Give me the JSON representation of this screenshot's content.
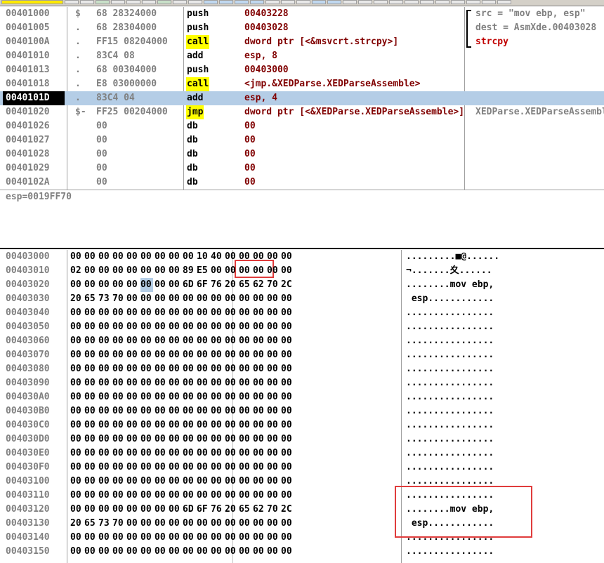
{
  "disasm": {
    "rows": [
      {
        "addr": "00401000",
        "mark": "$",
        "hex": "68 28324000",
        "mn": "push",
        "op": "00403228",
        "cm": "src = \"mov ebp, esp\""
      },
      {
        "addr": "00401005",
        "mark": ".",
        "hex": "68 28304000",
        "mn": "push",
        "op": "00403028",
        "cm": "dest = AsmXde.00403028"
      },
      {
        "addr": "0040100A",
        "mark": ".",
        "hex": "FF15 08204000",
        "mn": "call",
        "op": "dword ptr [<&msvcrt.strcpy>]",
        "cm": "strcpy"
      },
      {
        "addr": "00401010",
        "mark": ".",
        "hex": "83C4 08",
        "mn": "add",
        "op": "esp, 8",
        "cm": ""
      },
      {
        "addr": "00401013",
        "mark": ".",
        "hex": "68 00304000",
        "mn": "push",
        "op": "00403000",
        "cm": ""
      },
      {
        "addr": "00401018",
        "mark": ".",
        "hex": "E8 03000000",
        "mn": "call",
        "op": "<jmp.&XEDParse.XEDParseAssemble>",
        "cm": ""
      },
      {
        "addr": "0040101D",
        "mark": ".",
        "hex": "83C4 04",
        "mn": "add",
        "op": "esp, 4",
        "cm": ""
      },
      {
        "addr": "00401020",
        "mark": "$-",
        "hex": "FF25 00204000",
        "mn": "jmp",
        "op": "dword ptr [<&XEDParse.XEDParseAssemble>]",
        "cm": "XEDParse.XEDParseAssemble"
      },
      {
        "addr": "00401026",
        "mark": "",
        "hex": "00",
        "mn": "db",
        "op": "00",
        "cm": ""
      },
      {
        "addr": "00401027",
        "mark": "",
        "hex": "00",
        "mn": "db",
        "op": "00",
        "cm": ""
      },
      {
        "addr": "00401028",
        "mark": "",
        "hex": "00",
        "mn": "db",
        "op": "00",
        "cm": ""
      },
      {
        "addr": "00401029",
        "mark": "",
        "hex": "00",
        "mn": "db",
        "op": "00",
        "cm": ""
      },
      {
        "addr": "0040102A",
        "mark": "",
        "hex": "00",
        "mn": "db",
        "op": "00",
        "cm": ""
      }
    ]
  },
  "info": {
    "text": "esp=0019FF70"
  },
  "dump": {
    "rows": [
      {
        "addr": "00403000",
        "bytes": [
          "00",
          "00",
          "00",
          "00",
          "00",
          "00",
          "00",
          "00",
          "00",
          "10",
          "40",
          "00",
          "00",
          "00",
          "00",
          "00"
        ],
        "ascii": ".........■@......"
      },
      {
        "addr": "00403010",
        "bytes": [
          "02",
          "00",
          "00",
          "00",
          "00",
          "00",
          "00",
          "00",
          "89",
          "E5",
          "00",
          "00",
          "00",
          "00",
          "00",
          "00"
        ],
        "ascii": "¬.......夊......"
      },
      {
        "addr": "00403020",
        "bytes": [
          "00",
          "00",
          "00",
          "00",
          "00",
          "00",
          "00",
          "00",
          "6D",
          "6F",
          "76",
          "20",
          "65",
          "62",
          "70",
          "2C"
        ],
        "ascii": "........mov ebp,"
      },
      {
        "addr": "00403030",
        "bytes": [
          "20",
          "65",
          "73",
          "70",
          "00",
          "00",
          "00",
          "00",
          "00",
          "00",
          "00",
          "00",
          "00",
          "00",
          "00",
          "00"
        ],
        "ascii": " esp............"
      },
      {
        "addr": "00403040",
        "bytes": [
          "00",
          "00",
          "00",
          "00",
          "00",
          "00",
          "00",
          "00",
          "00",
          "00",
          "00",
          "00",
          "00",
          "00",
          "00",
          "00"
        ],
        "ascii": "................"
      },
      {
        "addr": "00403050",
        "bytes": [
          "00",
          "00",
          "00",
          "00",
          "00",
          "00",
          "00",
          "00",
          "00",
          "00",
          "00",
          "00",
          "00",
          "00",
          "00",
          "00"
        ],
        "ascii": "................"
      },
      {
        "addr": "00403060",
        "bytes": [
          "00",
          "00",
          "00",
          "00",
          "00",
          "00",
          "00",
          "00",
          "00",
          "00",
          "00",
          "00",
          "00",
          "00",
          "00",
          "00"
        ],
        "ascii": "................"
      },
      {
        "addr": "00403070",
        "bytes": [
          "00",
          "00",
          "00",
          "00",
          "00",
          "00",
          "00",
          "00",
          "00",
          "00",
          "00",
          "00",
          "00",
          "00",
          "00",
          "00"
        ],
        "ascii": "................"
      },
      {
        "addr": "00403080",
        "bytes": [
          "00",
          "00",
          "00",
          "00",
          "00",
          "00",
          "00",
          "00",
          "00",
          "00",
          "00",
          "00",
          "00",
          "00",
          "00",
          "00"
        ],
        "ascii": "................"
      },
      {
        "addr": "00403090",
        "bytes": [
          "00",
          "00",
          "00",
          "00",
          "00",
          "00",
          "00",
          "00",
          "00",
          "00",
          "00",
          "00",
          "00",
          "00",
          "00",
          "00"
        ],
        "ascii": "................"
      },
      {
        "addr": "004030A0",
        "bytes": [
          "00",
          "00",
          "00",
          "00",
          "00",
          "00",
          "00",
          "00",
          "00",
          "00",
          "00",
          "00",
          "00",
          "00",
          "00",
          "00"
        ],
        "ascii": "................"
      },
      {
        "addr": "004030B0",
        "bytes": [
          "00",
          "00",
          "00",
          "00",
          "00",
          "00",
          "00",
          "00",
          "00",
          "00",
          "00",
          "00",
          "00",
          "00",
          "00",
          "00"
        ],
        "ascii": "................"
      },
      {
        "addr": "004030C0",
        "bytes": [
          "00",
          "00",
          "00",
          "00",
          "00",
          "00",
          "00",
          "00",
          "00",
          "00",
          "00",
          "00",
          "00",
          "00",
          "00",
          "00"
        ],
        "ascii": "................"
      },
      {
        "addr": "004030D0",
        "bytes": [
          "00",
          "00",
          "00",
          "00",
          "00",
          "00",
          "00",
          "00",
          "00",
          "00",
          "00",
          "00",
          "00",
          "00",
          "00",
          "00"
        ],
        "ascii": "................"
      },
      {
        "addr": "004030E0",
        "bytes": [
          "00",
          "00",
          "00",
          "00",
          "00",
          "00",
          "00",
          "00",
          "00",
          "00",
          "00",
          "00",
          "00",
          "00",
          "00",
          "00"
        ],
        "ascii": "................"
      },
      {
        "addr": "004030F0",
        "bytes": [
          "00",
          "00",
          "00",
          "00",
          "00",
          "00",
          "00",
          "00",
          "00",
          "00",
          "00",
          "00",
          "00",
          "00",
          "00",
          "00"
        ],
        "ascii": "................"
      },
      {
        "addr": "00403100",
        "bytes": [
          "00",
          "00",
          "00",
          "00",
          "00",
          "00",
          "00",
          "00",
          "00",
          "00",
          "00",
          "00",
          "00",
          "00",
          "00",
          "00"
        ],
        "ascii": "................"
      },
      {
        "addr": "00403110",
        "bytes": [
          "00",
          "00",
          "00",
          "00",
          "00",
          "00",
          "00",
          "00",
          "00",
          "00",
          "00",
          "00",
          "00",
          "00",
          "00",
          "00"
        ],
        "ascii": "................"
      },
      {
        "addr": "00403120",
        "bytes": [
          "00",
          "00",
          "00",
          "00",
          "00",
          "00",
          "00",
          "00",
          "6D",
          "6F",
          "76",
          "20",
          "65",
          "62",
          "70",
          "2C"
        ],
        "ascii": "........mov ebp,"
      },
      {
        "addr": "00403130",
        "bytes": [
          "20",
          "65",
          "73",
          "70",
          "00",
          "00",
          "00",
          "00",
          "00",
          "00",
          "00",
          "00",
          "00",
          "00",
          "00",
          "00"
        ],
        "ascii": " esp............"
      },
      {
        "addr": "00403140",
        "bytes": [
          "00",
          "00",
          "00",
          "00",
          "00",
          "00",
          "00",
          "00",
          "00",
          "00",
          "00",
          "00",
          "00",
          "00",
          "00",
          "00"
        ],
        "ascii": "................"
      },
      {
        "addr": "00403150",
        "bytes": [
          "00",
          "00",
          "00",
          "00",
          "00",
          "00",
          "00",
          "00",
          "00",
          "00",
          "00",
          "00",
          "00",
          "00",
          "00",
          "00"
        ],
        "ascii": "................"
      }
    ]
  },
  "colors": {
    "selection": "#b4cde6",
    "highlight_call": "#ffff00",
    "annotation_box": "#e03c3c"
  }
}
